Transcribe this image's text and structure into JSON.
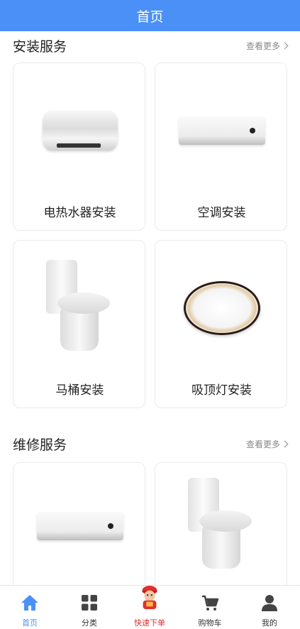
{
  "header": {
    "title": "首页"
  },
  "sections": [
    {
      "title": "安装服务",
      "more": "查看更多",
      "items": [
        {
          "label": "电热水器安装",
          "image": "water-heater"
        },
        {
          "label": "空调安装",
          "image": "air-conditioner"
        },
        {
          "label": "马桶安装",
          "image": "toilet"
        },
        {
          "label": "吸顶灯安装",
          "image": "ceiling-lamp"
        }
      ]
    },
    {
      "title": "维修服务",
      "more": "查看更多",
      "items": [
        {
          "image": "air-conditioner"
        },
        {
          "image": "toilet"
        }
      ]
    }
  ],
  "tabbar": [
    {
      "label": "首页",
      "icon": "home-icon",
      "active": true
    },
    {
      "label": "分类",
      "icon": "grid-icon"
    },
    {
      "label": "快速下单",
      "icon": "worker-mascot-icon"
    },
    {
      "label": "购物车",
      "icon": "cart-icon"
    },
    {
      "label": "我的",
      "icon": "user-icon"
    }
  ],
  "colors": {
    "primary": "#4a90f7",
    "quick_order": "#e0302b"
  }
}
